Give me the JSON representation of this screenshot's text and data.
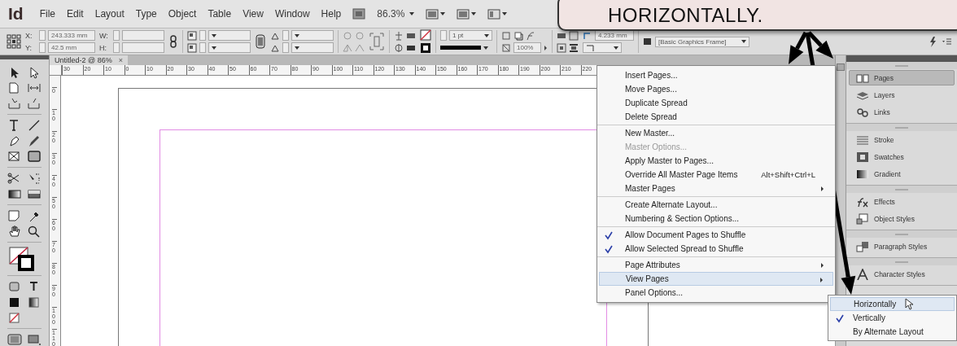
{
  "app": {
    "logo": "Id",
    "menus": [
      "File",
      "Edit",
      "Layout",
      "Type",
      "Object",
      "Table",
      "View",
      "Window",
      "Help"
    ],
    "zoom": "86.3%"
  },
  "control_bar": {
    "x_label": "X:",
    "x": "243.333 mm",
    "y_label": "Y:",
    "y": "42.5 mm",
    "w_label": "W:",
    "h_label": "H:",
    "stroke_weight": "1 pt",
    "opacity": "100%",
    "dimension": "4.233 mm",
    "object_style": "[Basic Graphics Frame]"
  },
  "document": {
    "tab": "Untitled-2 @ 86%",
    "tab_close": "×",
    "ruler_h": [
      "30",
      "20",
      "10",
      "0",
      "10",
      "20",
      "30",
      "40",
      "50",
      "60",
      "70",
      "80",
      "90",
      "100",
      "110",
      "120",
      "130",
      "140",
      "150",
      "160",
      "170",
      "180",
      "190",
      "200",
      "210",
      "220"
    ],
    "ruler_v": [
      "0",
      "10",
      "20",
      "30",
      "40",
      "50",
      "60",
      "70",
      "80",
      "90",
      "100",
      "110"
    ]
  },
  "pages_menu": {
    "groups": [
      [
        {
          "label": "Insert Pages...",
          "disabled": false,
          "checked": false,
          "submenu": false,
          "selected": false
        },
        {
          "label": "Move Pages...",
          "disabled": false,
          "checked": false,
          "submenu": false,
          "selected": false
        },
        {
          "label": "Duplicate Spread",
          "disabled": false,
          "checked": false,
          "submenu": false,
          "selected": false
        },
        {
          "label": "Delete Spread",
          "disabled": false,
          "checked": false,
          "submenu": false,
          "selected": false
        }
      ],
      [
        {
          "label": "New Master...",
          "disabled": false,
          "checked": false,
          "submenu": false,
          "selected": false
        },
        {
          "label": "Master Options...",
          "disabled": true,
          "checked": false,
          "submenu": false,
          "selected": false
        },
        {
          "label": "Apply Master to Pages...",
          "disabled": false,
          "checked": false,
          "submenu": false,
          "selected": false
        },
        {
          "label": "Override All Master Page Items",
          "shortcut": "Alt+Shift+Ctrl+L",
          "disabled": false,
          "checked": false,
          "submenu": false,
          "selected": false
        },
        {
          "label": "Master Pages",
          "disabled": false,
          "checked": false,
          "submenu": true,
          "selected": false
        }
      ],
      [
        {
          "label": "Create Alternate Layout...",
          "disabled": false,
          "checked": false,
          "submenu": false,
          "selected": false
        },
        {
          "label": "Numbering & Section Options...",
          "disabled": false,
          "checked": false,
          "submenu": false,
          "selected": false
        }
      ],
      [
        {
          "label": "Allow Document Pages to Shuffle",
          "disabled": false,
          "checked": true,
          "submenu": false,
          "selected": false
        },
        {
          "label": "Allow Selected Spread to Shuffle",
          "disabled": false,
          "checked": true,
          "submenu": false,
          "selected": false
        }
      ],
      [
        {
          "label": "Page Attributes",
          "disabled": false,
          "checked": false,
          "submenu": true,
          "selected": false
        },
        {
          "label": "View Pages",
          "disabled": false,
          "checked": false,
          "submenu": true,
          "selected": true
        },
        {
          "label": "Panel Options...",
          "disabled": false,
          "checked": false,
          "submenu": false,
          "selected": false
        }
      ]
    ]
  },
  "view_pages_submenu": {
    "items": [
      {
        "label": "Horizontally",
        "checked": false,
        "selected": true
      },
      {
        "label": "Vertically",
        "checked": true,
        "selected": false
      },
      {
        "label": "By Alternate Layout",
        "checked": false,
        "selected": false
      }
    ]
  },
  "panels": {
    "groups": [
      [
        {
          "label": "Pages",
          "selected": true
        },
        {
          "label": "Layers",
          "selected": false
        },
        {
          "label": "Links",
          "selected": false
        }
      ],
      [
        {
          "label": "Stroke",
          "selected": false
        },
        {
          "label": "Swatches",
          "selected": false
        },
        {
          "label": "Gradient",
          "selected": false
        }
      ],
      [
        {
          "label": "Effects",
          "selected": false
        },
        {
          "label": "Object Styles",
          "selected": false
        }
      ],
      [
        {
          "label": "Paragraph Styles",
          "selected": false
        }
      ],
      [
        {
          "label": "Character Styles",
          "selected": false
        }
      ]
    ]
  },
  "callout": {
    "text": "HORIZONTALLY."
  }
}
